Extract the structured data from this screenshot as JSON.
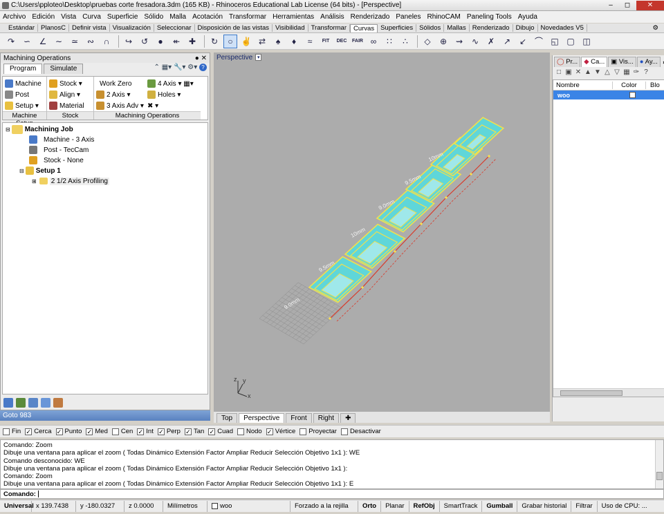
{
  "window": {
    "title": "C:\\Users\\pploteo\\Desktop\\pruebas corte fresadora.3dm (165 KB) - Rhinoceros Educational Lab License (64 bits) - [Perspective]"
  },
  "menu": [
    "Archivo",
    "Edición",
    "Vista",
    "Curva",
    "Superficie",
    "Sólido",
    "Malla",
    "Acotación",
    "Transformar",
    "Herramientas",
    "Análisis",
    "Renderizado",
    "Paneles",
    "RhinoCAM",
    "Paneling Tools",
    "Ayuda"
  ],
  "toolbar_tabs": [
    "Estándar",
    "PlanosC",
    "Definir vista",
    "Visualización",
    "Seleccionar",
    "Disposición de las vistas",
    "Visibilidad",
    "Transformar",
    "Curvas",
    "Superficies",
    "Sólidos",
    "Mallas",
    "Renderizado",
    "Dibujo",
    "Novedades V5"
  ],
  "active_toolbar_tab": "Curvas",
  "toolbar_icon_labels": [
    "FIT",
    "DEC",
    "FAIR"
  ],
  "machining": {
    "title": "Machining Operations",
    "tabs": [
      "Program",
      "Simulate"
    ],
    "groups": {
      "machine_setup": {
        "title": "Machine Setup",
        "items": [
          "Machine",
          "Post",
          "Setup"
        ]
      },
      "stock": {
        "title": "Stock",
        "items": [
          "Stock",
          "Align",
          "Material"
        ]
      },
      "ops": {
        "title": "Machining Operations",
        "items": [
          "Work Zero",
          "2 Axis",
          "3 Axis Adv",
          "4 Axis",
          "Holes"
        ]
      }
    },
    "tree": {
      "job": "Machining Job",
      "machine": "Machine - 3 Axis",
      "post": "Post - TecCam",
      "stock": "Stock - None",
      "setup": "Setup 1",
      "op": "2 1/2 Axis Profiling"
    },
    "goto": "Goto 983"
  },
  "viewport": {
    "name": "Perspective",
    "tabs": [
      "Top",
      "Perspective",
      "Front",
      "Right"
    ],
    "active_tab": "Perspective",
    "labels": [
      "9.0mm",
      "9.5mm",
      "10mm",
      "9.0mm",
      "9.5mm",
      "10mm"
    ],
    "axes": {
      "x": "x",
      "y": "y",
      "z": "z"
    }
  },
  "layers": {
    "tabs": [
      "Pr...",
      "Ca...",
      "Vis...",
      "Ay..."
    ],
    "columns": [
      "Nombre",
      "Color",
      "Blo"
    ],
    "rows": [
      {
        "name": "woo"
      }
    ]
  },
  "osnaps": [
    {
      "label": "Fin",
      "checked": false
    },
    {
      "label": "Cerca",
      "checked": true
    },
    {
      "label": "Punto",
      "checked": true
    },
    {
      "label": "Med",
      "checked": true
    },
    {
      "label": "Cen",
      "checked": false
    },
    {
      "label": "Int",
      "checked": true
    },
    {
      "label": "Perp",
      "checked": true
    },
    {
      "label": "Tan",
      "checked": true
    },
    {
      "label": "Cuad",
      "checked": true
    },
    {
      "label": "Nodo",
      "checked": false
    },
    {
      "label": "Vértice",
      "checked": true
    },
    {
      "label": "Proyectar",
      "checked": false
    },
    {
      "label": "Desactivar",
      "checked": false
    }
  ],
  "command_history": [
    "Comando: Zoom",
    "Dibuje una ventana para aplicar el zoom ( Todas  Dinámico  Extensión  Factor  Ampliar  Reducir  Selección  Objetivo  1x1 ): WE",
    "Comando desconocido: WE",
    "Dibuje una ventana para aplicar el zoom ( Todas  Dinámico  Extensión  Factor  Ampliar  Reducir  Selección  Objetivo  1x1 ):",
    "Comando: Zoom",
    "Dibuje una ventana para aplicar el zoom ( Todas  Dinámico  Extensión  Factor  Ampliar  Reducir  Selección  Objetivo  1x1 ): E"
  ],
  "command_prompt": "Comando:",
  "status": {
    "plane": "Universal",
    "x": "x 139.7438",
    "y": "y -180.0327",
    "z": "z 0.0000",
    "units": "Milímetros",
    "layer": "woo",
    "items": [
      "Forzado a la rejilla",
      "Orto",
      "Planar",
      "RefObj",
      "SmartTrack",
      "Gumball",
      "Grabar historial",
      "Filtrar",
      "Uso de CPU: ..."
    ]
  },
  "colors": {
    "part_fill": "#5fd6d9",
    "part_outline": "#f0e04c",
    "toolpath": "#d83a2a",
    "layer_select": "#3a84e6",
    "viewport_bg": "#acacac"
  }
}
